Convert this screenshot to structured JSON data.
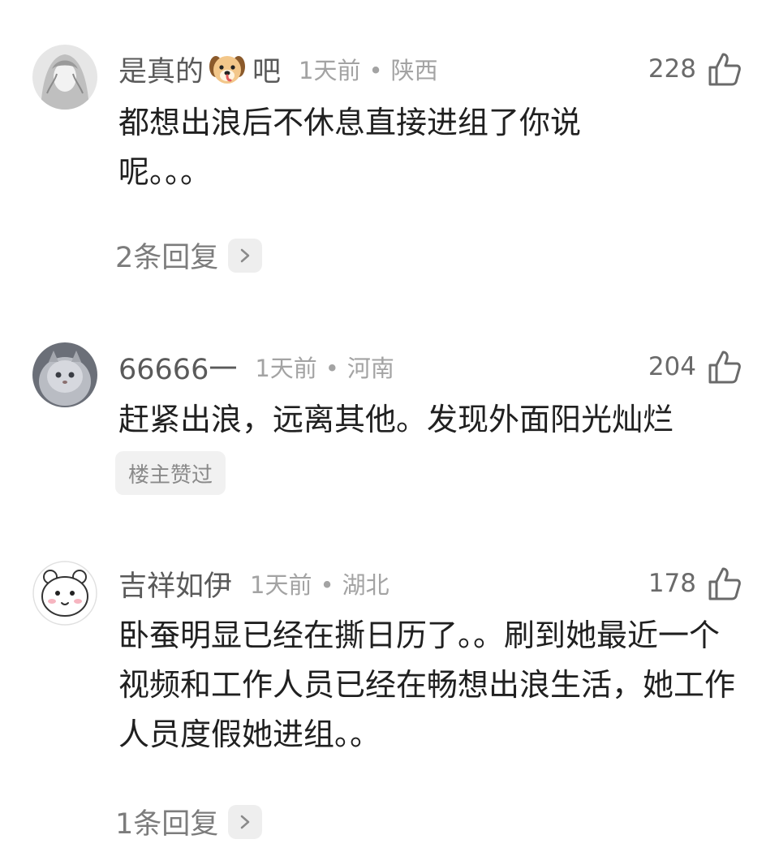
{
  "comments": [
    {
      "username": "是真的",
      "username_suffix": "吧",
      "username_emoji": "dog-face-emoji",
      "time": "1天前",
      "separator": "•",
      "location": "陕西",
      "likes": "228",
      "text": "都想出浪后不休息直接进组了你说呢。。。",
      "replies_label": "2条回复",
      "avatar": "woman-sketch-avatar"
    },
    {
      "username": "66666一",
      "time": "1天前",
      "separator": "•",
      "location": "河南",
      "likes": "204",
      "text": "赶紧出浪，远离其他。发现外面阳光灿烂",
      "badge": "楼主赞过",
      "avatar": "gray-cat-avatar"
    },
    {
      "username": "吉祥如伊",
      "time": "1天前",
      "separator": "•",
      "location": "湖北",
      "likes": "178",
      "text": "卧蚕明显已经在撕日历了。。刷到她最近一个视频和工作人员已经在畅想出浪生活，她工作人员度假她进组。。",
      "replies_label": "1条回复",
      "avatar": "cartoon-bear-avatar"
    }
  ],
  "icons": {
    "like": "thumbs-up-outline-icon",
    "chevron": "chevron-right-icon"
  },
  "colors": {
    "username": "#5a5a5a",
    "meta": "#a3a3a3",
    "body_text": "#202020",
    "chip_bg": "#eeeeee"
  }
}
